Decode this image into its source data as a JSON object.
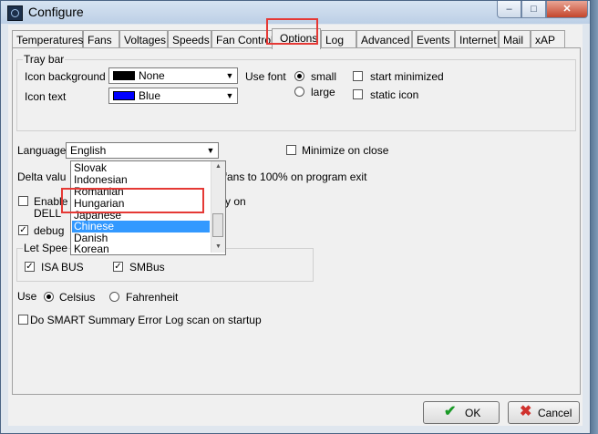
{
  "window": {
    "title": "Configure",
    "min_glyph": "–",
    "max_glyph": "□",
    "close_glyph": "✕",
    "icon": "app-icon"
  },
  "tabs": [
    "Temperatures",
    "Fans",
    "Voltages",
    "Speeds",
    "Fan Control",
    "Options",
    "Log",
    "Advanced",
    "Events",
    "Internet",
    "Mail",
    "xAP"
  ],
  "active_tab": "Options",
  "tray_bar": {
    "title": "Tray bar",
    "icon_background_label": "Icon background",
    "icon_background_value": "None",
    "icon_background_color": "#000000",
    "icon_text_label": "Icon text",
    "icon_text_value": "Blue",
    "icon_text_color": "#0000ff",
    "use_font_label": "Use font",
    "font_small": "small",
    "font_large": "large",
    "start_minimized": "start minimized",
    "static_icon": "static icon"
  },
  "language": {
    "label": "Language",
    "value": "English",
    "options": [
      "Slovak",
      "Indonesian",
      "Romanian",
      "Hungarian",
      "Japanese",
      "Chinese",
      "Danish",
      "Korean"
    ],
    "selected": "Chinese"
  },
  "minimize_on_close": "Minimize on close",
  "delta_prefix": "Delta valu",
  "fans_text": "t fans to 100% on program exit",
  "enable_prefix": "Enable",
  "enable_suffix": "y on",
  "dell_prefix": "DELL",
  "debug_prefix": "debug",
  "let_speed_title": "Let Spee",
  "isa_bus": "ISA BUS",
  "smbus": "SMBus",
  "use_label": "Use",
  "celsius": "Celsius",
  "fahrenheit": "Fahrenheit",
  "smart_scan": "Do SMART Summary Error Log scan on startup",
  "checked_mark": "✓",
  "buttons": {
    "ok": "OK",
    "cancel": "Cancel",
    "ok_icon": "✔",
    "cancel_icon": "✖"
  }
}
